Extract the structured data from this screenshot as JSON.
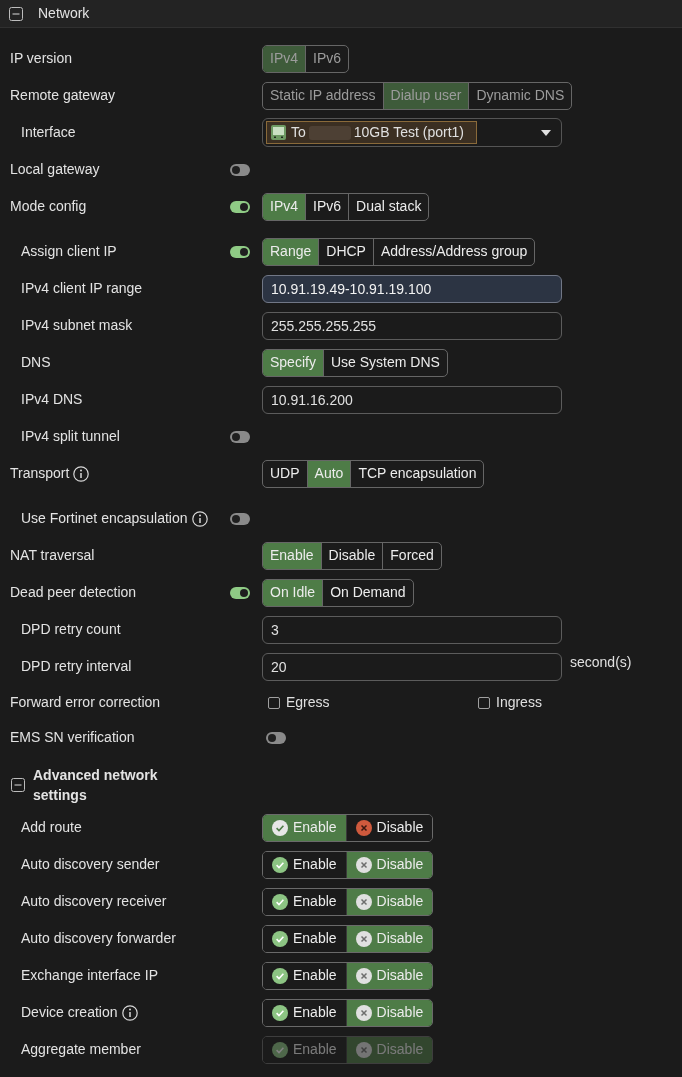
{
  "section": {
    "title": "Network",
    "expanded": true
  },
  "rows": [
    {
      "kind": "segmented",
      "label": "IP version",
      "disabled": true,
      "options": [
        {
          "label": "IPv4",
          "selected": true
        },
        {
          "label": "IPv6",
          "selected": false
        }
      ]
    },
    {
      "kind": "segmented",
      "label": "Remote gateway",
      "disabled": true,
      "options": [
        {
          "label": "Static IP address",
          "selected": false
        },
        {
          "label": "Dialup user",
          "selected": true
        },
        {
          "label": "Dynamic DNS",
          "selected": false
        }
      ],
      "children": [
        {
          "kind": "select",
          "label": "Interface",
          "value_start": "To",
          "value_end": "10GB Test (port1)"
        }
      ]
    },
    {
      "kind": "toggle",
      "label": "Local gateway",
      "toggle": {
        "on": false
      }
    },
    {
      "kind": "segmented",
      "label": "Mode config",
      "disabled": false,
      "toggle": {
        "on": true
      },
      "options": [
        {
          "label": "IPv4",
          "selected": true
        },
        {
          "label": "IPv6",
          "selected": false
        },
        {
          "label": "Dual stack",
          "selected": false
        }
      ],
      "children": [
        {
          "kind": "segmented",
          "label": "Assign client IP",
          "disabled": false,
          "toggle": {
            "on": true
          },
          "options": [
            {
              "label": "Range",
              "selected": true
            },
            {
              "label": "DHCP",
              "selected": false
            },
            {
              "label": "Address/Address group",
              "selected": false
            }
          ]
        },
        {
          "kind": "field",
          "label": "IPv4 client IP range",
          "value": "10.91.19.49-10.91.19.100",
          "focused": true
        },
        {
          "kind": "field",
          "label": "IPv4 subnet mask",
          "value": "255.255.255.255",
          "focused": false
        },
        {
          "kind": "segmented",
          "label": "DNS",
          "disabled": false,
          "options": [
            {
              "label": "Specify",
              "selected": true
            },
            {
              "label": "Use System DNS",
              "selected": false
            }
          ]
        },
        {
          "kind": "field",
          "label": "IPv4 DNS",
          "value": "10.91.16.200",
          "focused": false
        },
        {
          "kind": "toggle",
          "label": "IPv4 split tunnel",
          "toggle": {
            "on": false
          }
        }
      ]
    },
    {
      "kind": "segmented",
      "label": "Transport",
      "info": true,
      "disabled": false,
      "options": [
        {
          "label": "UDP",
          "selected": false
        },
        {
          "label": "Auto",
          "selected": true
        },
        {
          "label": "TCP encapsulation",
          "selected": false
        }
      ],
      "children": [
        {
          "kind": "toggle",
          "label": "Use Fortinet encapsulation",
          "info": true,
          "toggle": {
            "on": false
          }
        }
      ]
    },
    {
      "kind": "segmented",
      "label": "NAT traversal",
      "disabled": false,
      "options": [
        {
          "label": "Enable",
          "selected": true
        },
        {
          "label": "Disable",
          "selected": false
        },
        {
          "label": "Forced",
          "selected": false
        }
      ]
    },
    {
      "kind": "segmented",
      "label": "Dead peer detection",
      "disabled": false,
      "toggle": {
        "on": true
      },
      "options": [
        {
          "label": "On Idle",
          "selected": true
        },
        {
          "label": "On Demand",
          "selected": false
        }
      ],
      "children": [
        {
          "kind": "field",
          "label": "DPD retry count",
          "value": "3",
          "focused": false
        },
        {
          "kind": "field",
          "label": "DPD retry interval",
          "value": "20",
          "focused": false,
          "suffix": "second(s)"
        }
      ]
    },
    {
      "kind": "checkboxes",
      "label": "Forward error correction",
      "options": [
        {
          "label": "Egress",
          "checked": false
        },
        {
          "label": "Ingress",
          "checked": false
        }
      ]
    },
    {
      "kind": "switch",
      "label": "EMS SN verification",
      "on": false
    }
  ],
  "advanced": {
    "title": "Advanced network settings",
    "expanded": true,
    "rows": [
      {
        "kind": "enable_disable",
        "label": "Add route",
        "disabled": false,
        "options": [
          {
            "kind": "enable",
            "label": "Enable",
            "selected": true
          },
          {
            "kind": "disable",
            "label": "Disable",
            "selected": false
          }
        ]
      },
      {
        "kind": "enable_disable",
        "label": "Auto discovery sender",
        "disabled": false,
        "options": [
          {
            "kind": "enable",
            "label": "Enable",
            "selected": false
          },
          {
            "kind": "disable",
            "label": "Disable",
            "selected": true
          }
        ]
      },
      {
        "kind": "enable_disable",
        "label": "Auto discovery receiver",
        "disabled": false,
        "options": [
          {
            "kind": "enable",
            "label": "Enable",
            "selected": false
          },
          {
            "kind": "disable",
            "label": "Disable",
            "selected": true
          }
        ]
      },
      {
        "kind": "enable_disable",
        "label": "Auto discovery forwarder",
        "disabled": false,
        "options": [
          {
            "kind": "enable",
            "label": "Enable",
            "selected": false
          },
          {
            "kind": "disable",
            "label": "Disable",
            "selected": true
          }
        ]
      },
      {
        "kind": "enable_disable",
        "label": "Exchange interface IP",
        "disabled": false,
        "options": [
          {
            "kind": "enable",
            "label": "Enable",
            "selected": false
          },
          {
            "kind": "disable",
            "label": "Disable",
            "selected": true
          }
        ]
      },
      {
        "kind": "enable_disable",
        "label": "Device creation",
        "info": true,
        "disabled": false,
        "options": [
          {
            "kind": "enable",
            "label": "Enable",
            "selected": false
          },
          {
            "kind": "disable",
            "label": "Disable",
            "selected": true
          }
        ]
      },
      {
        "kind": "enable_disable",
        "label": "Aggregate member",
        "disabled": true,
        "options": [
          {
            "kind": "enable",
            "label": "Enable",
            "selected": false
          },
          {
            "kind": "disable",
            "label": "Disable",
            "selected": true
          }
        ]
      }
    ]
  }
}
